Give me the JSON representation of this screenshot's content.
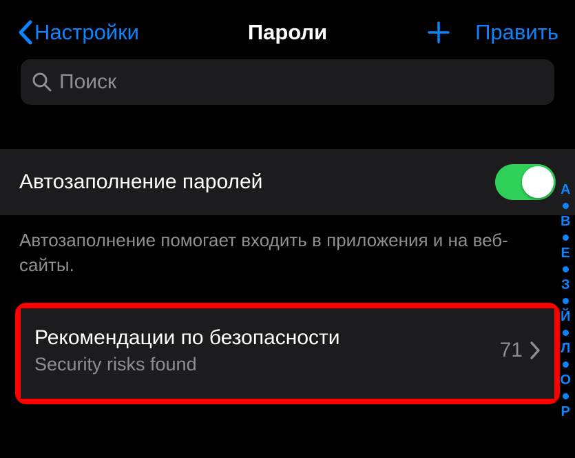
{
  "nav": {
    "back_label": "Настройки",
    "title": "Пароли",
    "edit_label": "Править"
  },
  "search": {
    "placeholder": "Поиск"
  },
  "autofill": {
    "label": "Автозаполнение паролей",
    "enabled": true,
    "footer": "Автозаполнение помогает входить в приложения и на веб-сайты."
  },
  "security": {
    "title": "Рекомендации по безопасности",
    "subtitle": "Security risks found",
    "count": "71"
  },
  "index": [
    "А",
    "В",
    "Е",
    "З",
    "Й",
    "Л",
    "О",
    "Р"
  ]
}
